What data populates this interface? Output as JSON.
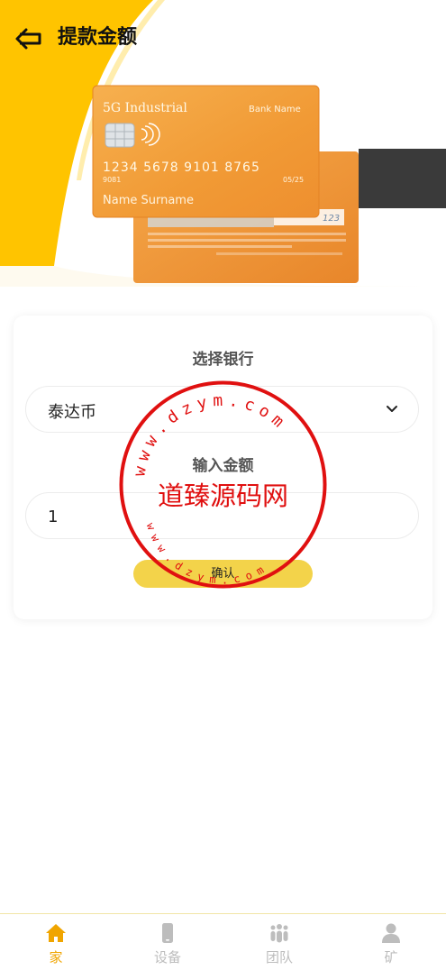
{
  "header": {
    "title": "提款金额"
  },
  "card": {
    "brand": "5G Industrial",
    "bank_name": "Bank Name",
    "number": "1234  5678  9101  8765",
    "small_number": "9081",
    "valid": "05/25",
    "holder": "Name Surname",
    "cvv": "123"
  },
  "form": {
    "bank_label": "选择银行",
    "bank_value": "泰达币",
    "amount_label": "输入金额",
    "amount_value": "1",
    "confirm_label": "确认"
  },
  "watermark": {
    "center_text": "道臻源码网",
    "ring_text": "www.dzym.com"
  },
  "colors": {
    "accent": "#f0a500",
    "brand_yellow": "#ffc400",
    "button": "#f3d34a"
  },
  "tabbar": {
    "items": [
      {
        "label": "家",
        "icon": "home-icon",
        "active": true
      },
      {
        "label": "设备",
        "icon": "device-icon",
        "active": false
      },
      {
        "label": "团队",
        "icon": "team-icon",
        "active": false
      },
      {
        "label": "矿",
        "icon": "user-icon",
        "active": false
      }
    ]
  }
}
